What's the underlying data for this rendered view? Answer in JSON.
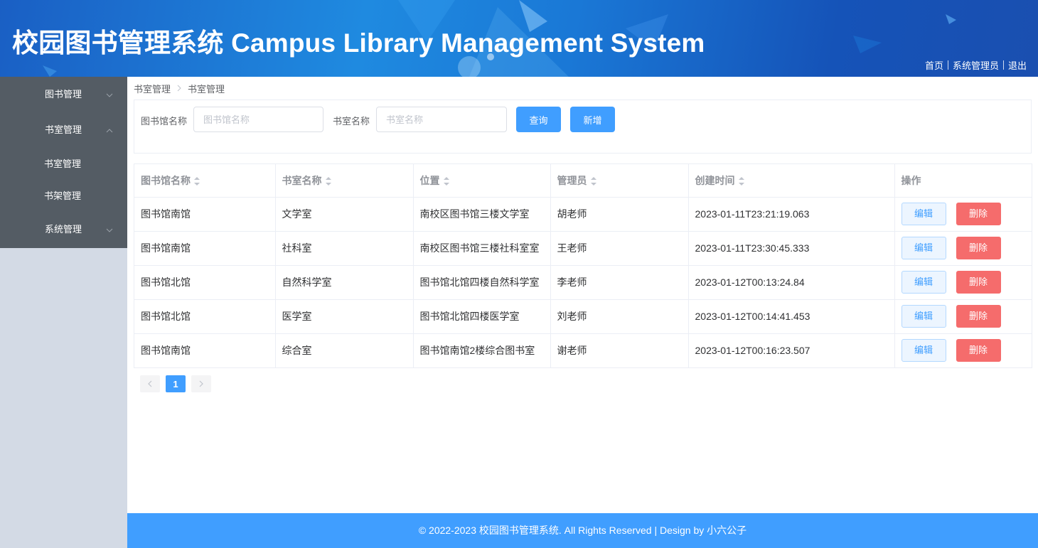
{
  "header": {
    "title": "校园图书管理系统 Campus Library Management System",
    "nav": [
      {
        "label": "首页"
      },
      {
        "label": "系统管理员"
      },
      {
        "label": "退出"
      }
    ]
  },
  "sidebar": {
    "menus": [
      {
        "label": "图书管理",
        "expanded": false
      },
      {
        "label": "书室管理",
        "expanded": true,
        "children": [
          {
            "label": "书室管理"
          },
          {
            "label": "书架管理"
          }
        ]
      },
      {
        "label": "系统管理",
        "expanded": false
      }
    ]
  },
  "breadcrumb": {
    "parent": "书室管理",
    "current": "书室管理"
  },
  "search": {
    "library_label": "图书馆名称",
    "library_placeholder": "图书馆名称",
    "library_value": "",
    "room_label": "书室名称",
    "room_placeholder": "书室名称",
    "room_value": "",
    "query_button": "查询",
    "add_button": "新增"
  },
  "table": {
    "columns": [
      "图书馆名称",
      "书室名称",
      "位置",
      "管理员",
      "创建时间",
      "操作"
    ],
    "rows": [
      {
        "library": "图书馆南馆",
        "room": "文学室",
        "location": "南校区图书馆三楼文学室",
        "admin": "胡老师",
        "created": "2023-01-11T23:21:19.063"
      },
      {
        "library": "图书馆南馆",
        "room": "社科室",
        "location": "南校区图书馆三楼社科室室",
        "admin": "王老师",
        "created": "2023-01-11T23:30:45.333"
      },
      {
        "library": "图书馆北馆",
        "room": "自然科学室",
        "location": "图书馆北馆四楼自然科学室",
        "admin": "李老师",
        "created": "2023-01-12T00:13:24.84"
      },
      {
        "library": "图书馆北馆",
        "room": "医学室",
        "location": "图书馆北馆四楼医学室",
        "admin": "刘老师",
        "created": "2023-01-12T00:14:41.453"
      },
      {
        "library": "图书馆南馆",
        "room": "综合室",
        "location": "图书馆南馆2楼综合图书室",
        "admin": "谢老师",
        "created": "2023-01-12T00:16:23.507"
      }
    ],
    "edit_label": "编辑",
    "delete_label": "删除"
  },
  "pagination": {
    "current_page": "1"
  },
  "footer": {
    "text": "© 2022-2023 校园图书管理系统. All Rights Reserved | Design by 小六公子"
  },
  "colors": {
    "primary": "#409eff",
    "danger": "#f56c6c",
    "sidebar": "#545c64"
  }
}
